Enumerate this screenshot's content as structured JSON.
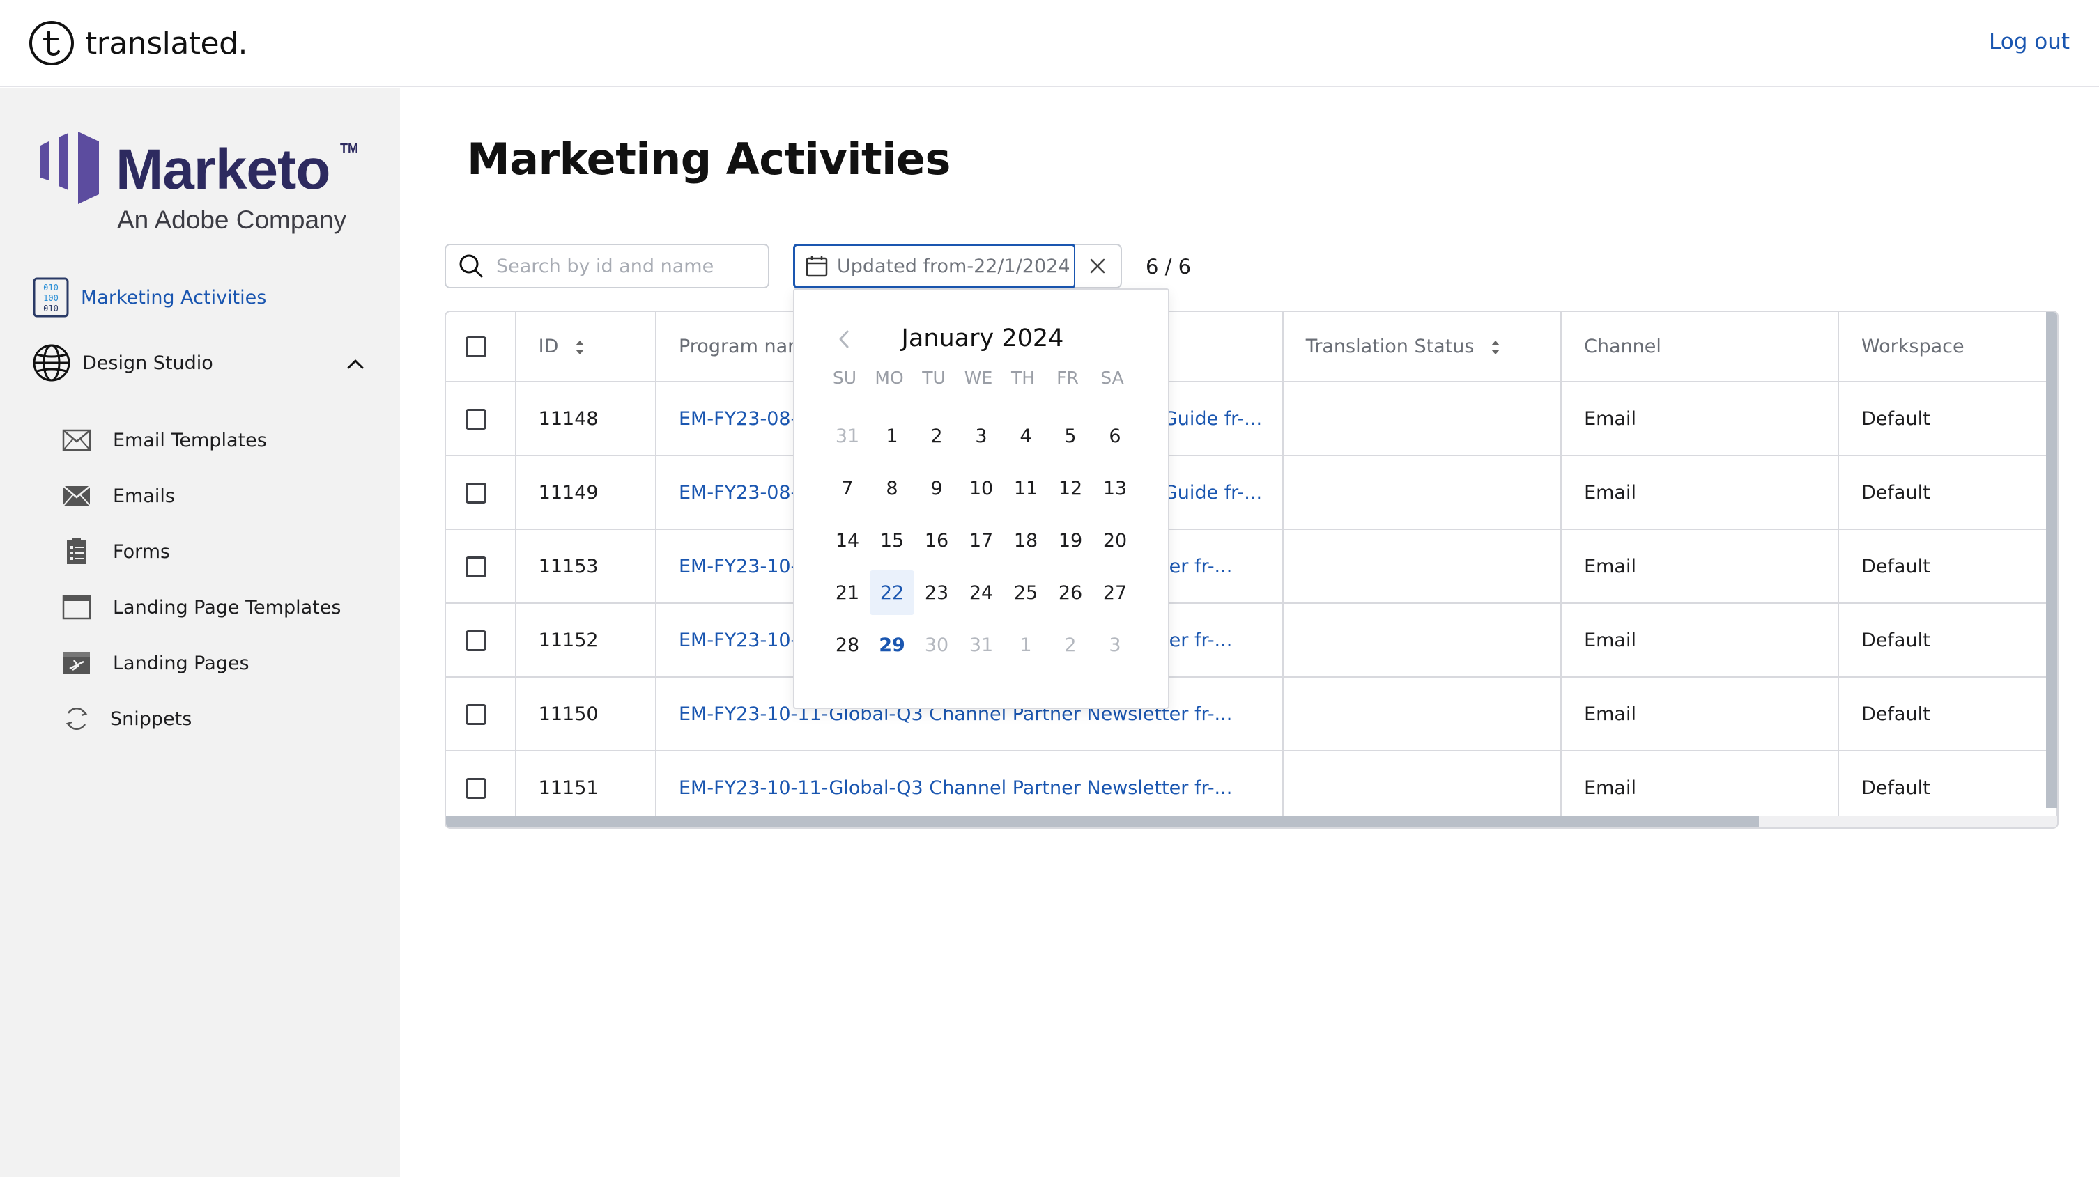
{
  "app": {
    "brand_name": "translated.",
    "logout_label": "Log out"
  },
  "sidebar": {
    "logo_word": "Marketo",
    "logo_tm": "TM",
    "logo_sub": "An Adobe Company",
    "marketing_activities": "Marketing Activities",
    "design_studio": "Design Studio",
    "sub_items": [
      {
        "label": "Email Templates",
        "icon": "email-template-icon"
      },
      {
        "label": "Emails",
        "icon": "email-icon"
      },
      {
        "label": "Forms",
        "icon": "form-icon"
      },
      {
        "label": "Landing Page Templates",
        "icon": "landing-template-icon"
      },
      {
        "label": "Landing Pages",
        "icon": "landing-page-icon"
      },
      {
        "label": "Snippets",
        "icon": "snippet-icon"
      }
    ]
  },
  "main": {
    "title": "Marketing Activities",
    "search_placeholder": "Search by id and name",
    "date_filter": "Updated from-22/1/2024",
    "count": "6 / 6"
  },
  "table": {
    "headers": {
      "id": "ID",
      "program_name": "Program name",
      "translation_status": "Translation Status",
      "channel": "Channel",
      "workspace": "Workspace"
    },
    "rows": [
      {
        "id": "11148",
        "name": "EM-FY23-08-XX-Global-Q3 Partner Program Update Guide fr-...",
        "status": "",
        "channel": "Email",
        "workspace": "Default"
      },
      {
        "id": "11149",
        "name": "EM-FY23-08-XX-Global-Q3 Partner Program Update Guide fr-...",
        "status": "",
        "channel": "Email",
        "workspace": "Default"
      },
      {
        "id": "11153",
        "name": "EM-FY23-10-11-Global-Q3 Channel Partner Newsletter fr-...",
        "status": "",
        "channel": "Email",
        "workspace": "Default"
      },
      {
        "id": "11152",
        "name": "EM-FY23-10-11-Global-Q3 Channel Partner Newsletter fr-...",
        "status": "",
        "channel": "Email",
        "workspace": "Default"
      },
      {
        "id": "11150",
        "name": "EM-FY23-10-11-Global-Q3 Channel Partner Newsletter fr-...",
        "status": "",
        "channel": "Email",
        "workspace": "Default"
      },
      {
        "id": "11151",
        "name": "EM-FY23-10-11-Global-Q3 Channel Partner Newsletter fr-...",
        "status": "",
        "channel": "Email",
        "workspace": "Default"
      }
    ]
  },
  "calendar": {
    "month_label": "January 2024",
    "weekdays": [
      "SU",
      "MO",
      "TU",
      "WE",
      "TH",
      "FR",
      "SA"
    ],
    "days": [
      {
        "d": "31",
        "muted": true
      },
      {
        "d": "1"
      },
      {
        "d": "2"
      },
      {
        "d": "3"
      },
      {
        "d": "4"
      },
      {
        "d": "5"
      },
      {
        "d": "6"
      },
      {
        "d": "7"
      },
      {
        "d": "8"
      },
      {
        "d": "9"
      },
      {
        "d": "10"
      },
      {
        "d": "11"
      },
      {
        "d": "12"
      },
      {
        "d": "13"
      },
      {
        "d": "14"
      },
      {
        "d": "15"
      },
      {
        "d": "16"
      },
      {
        "d": "17"
      },
      {
        "d": "18"
      },
      {
        "d": "19"
      },
      {
        "d": "20"
      },
      {
        "d": "21"
      },
      {
        "d": "22",
        "today": true
      },
      {
        "d": "23"
      },
      {
        "d": "24"
      },
      {
        "d": "25"
      },
      {
        "d": "26"
      },
      {
        "d": "27"
      },
      {
        "d": "28"
      },
      {
        "d": "29",
        "selected": true
      },
      {
        "d": "30",
        "muted": true
      },
      {
        "d": "31",
        "muted": true
      },
      {
        "d": "1",
        "muted": true
      },
      {
        "d": "2",
        "muted": true
      },
      {
        "d": "3",
        "muted": true
      }
    ]
  },
  "colors": {
    "accent": "#1a56b0",
    "sidebar_bg": "#f2f2f2",
    "marketo_purple": "#5c4c9f"
  }
}
